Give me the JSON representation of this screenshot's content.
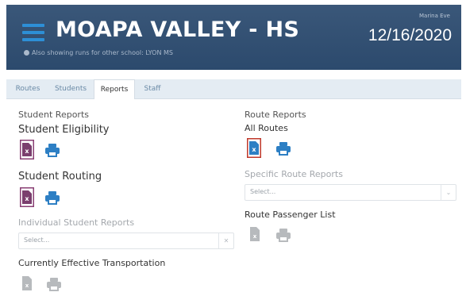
{
  "header": {
    "school_name": "MOAPA VALLEY - HS",
    "also_showing_note": "Also showing runs for other school: LYON MS",
    "user_name": "Marina Eve",
    "date": "12/16/2020"
  },
  "tabs": [
    {
      "label": "Routes",
      "active": false
    },
    {
      "label": "Students",
      "active": false
    },
    {
      "label": "Reports",
      "active": true
    },
    {
      "label": "Staff",
      "active": false
    }
  ],
  "student_reports": {
    "section_title": "Student Reports",
    "eligibility_title": "Student Eligibility",
    "routing_title": "Student Routing",
    "individual_title": "Individual Student Reports",
    "individual_select_placeholder": "Select...",
    "effective_title": "Currently Effective Transportation"
  },
  "route_reports": {
    "section_title": "Route Reports",
    "all_routes_title": "All Routes",
    "specific_title": "Specific Route Reports",
    "specific_select_placeholder": "Select...",
    "passenger_list_title": "Route Passenger List"
  },
  "colors": {
    "header_bg": "#34527a",
    "accent_blue": "#2d7fc4",
    "excel_purple": "#7b3f6e",
    "highlight_border": "#c0392b",
    "disabled_grey": "#b7babd"
  },
  "icons": {
    "menu": "hamburger-icon",
    "info": "info-icon",
    "excel": "excel-icon",
    "print": "print-icon"
  }
}
